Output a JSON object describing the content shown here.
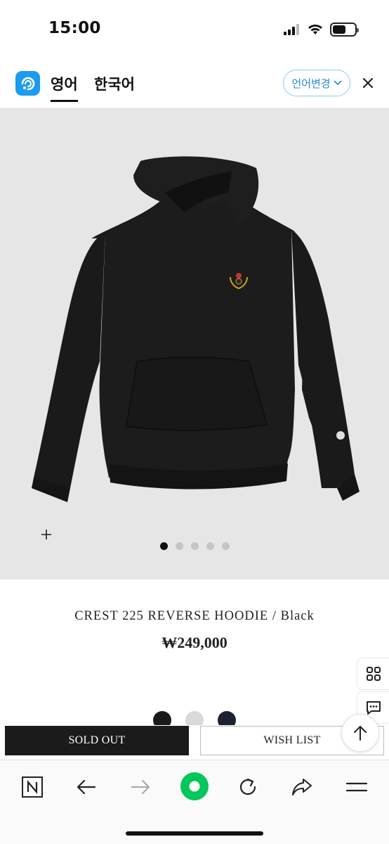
{
  "status_bar": {
    "time": "15:00"
  },
  "translate_bar": {
    "tab_english": "영어",
    "tab_korean": "한국어",
    "change_language_label": "언어변경"
  },
  "product": {
    "name": "CREST 225 REVERSE HOODIE / Black",
    "price": "₩249,000",
    "image_count": 5,
    "active_image_index": 0,
    "color_swatches": [
      "#1a1a1a",
      "#d9d9d9",
      "#1e2230"
    ]
  },
  "actions": {
    "sold_out_label": "SOLD OUT",
    "wish_list_label": "WISH LIST"
  },
  "icons": {
    "status": [
      "signal-icon",
      "wifi-icon",
      "battery-icon"
    ],
    "side": [
      "grid-icon",
      "chat-icon"
    ],
    "toolbar": [
      "naver-n-icon",
      "back-arrow-icon",
      "forward-arrow-icon",
      "naver-green-home-icon",
      "refresh-icon",
      "share-icon",
      "menu-icon"
    ]
  },
  "colors": {
    "accent_blue": "#1c9bf0",
    "naver_green": "#03c75a",
    "sold_out_bg": "#1b1b1b"
  }
}
